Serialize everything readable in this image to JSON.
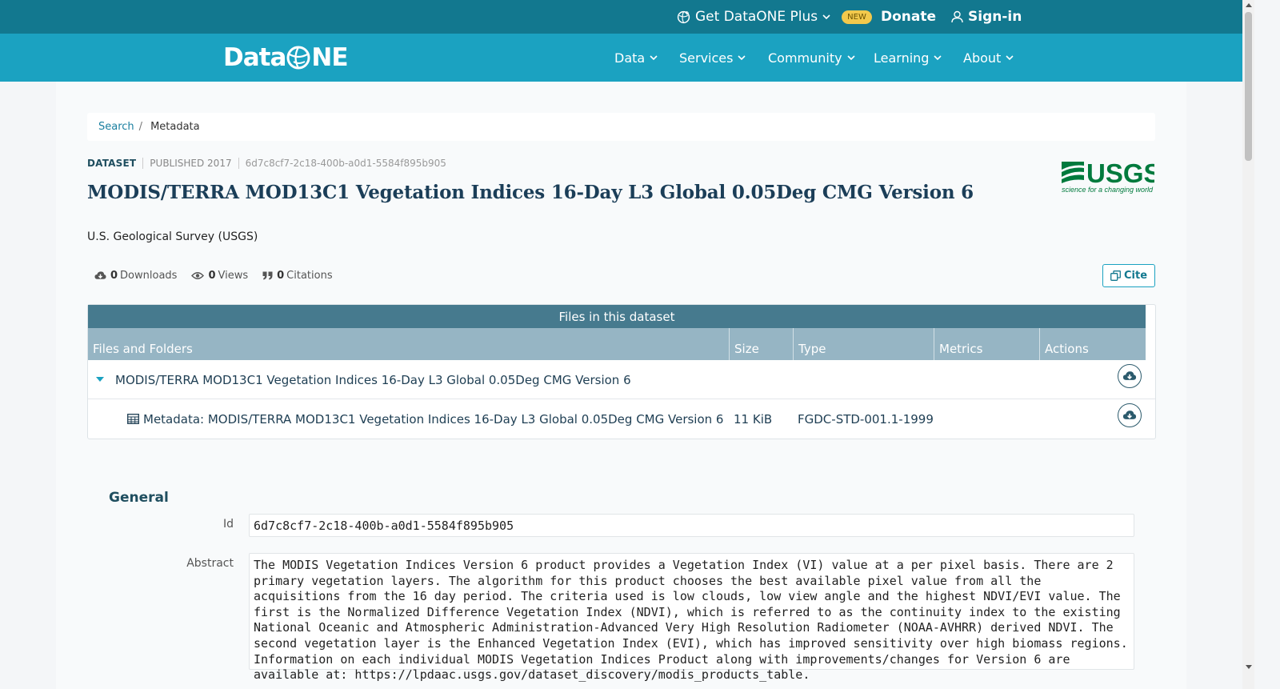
{
  "topbar": {
    "plus_label": "Get DataONE Plus",
    "new_badge": "NEW",
    "donate_label": "Donate",
    "signin_label": "Sign-in"
  },
  "logo": {
    "left": "Data",
    "right": "NE"
  },
  "nav": {
    "items": [
      {
        "label": "Data"
      },
      {
        "label": "Services"
      },
      {
        "label": "Community"
      },
      {
        "label": "Learning"
      },
      {
        "label": "About"
      }
    ]
  },
  "breadcrumb": {
    "search": "Search",
    "sep": "/",
    "current": "Metadata"
  },
  "dataset": {
    "type": "DATASET",
    "published": "PUBLISHED 2017",
    "id": "6d7c8cf7-2c18-400b-a0d1-5584f895b905",
    "title": "MODIS/TERRA MOD13C1 Vegetation Indices 16-Day L3 Global 0.05Deg CMG Version 6",
    "organization": "U.S. Geological Survey (USGS)"
  },
  "usgs_logo": {
    "text": "USGS",
    "tagline": "science for a changing world",
    "color": "#007a3d"
  },
  "metrics": {
    "downloads": {
      "count": "0",
      "label": "Downloads"
    },
    "views": {
      "count": "0",
      "label": "Views"
    },
    "citations": {
      "count": "0",
      "label": "Citations"
    }
  },
  "cite_label": "Cite",
  "files": {
    "caption": "Files in this dataset",
    "columns": [
      "Files and Folders",
      "Size",
      "Type",
      "Metrics",
      "Actions"
    ],
    "folder": {
      "name": "MODIS/TERRA MOD13C1 Vegetation Indices 16-Day L3 Global 0.05Deg CMG Version 6"
    },
    "rows": [
      {
        "name": "Metadata: MODIS/TERRA MOD13C1 Vegetation Indices 16-Day L3 Global 0.05Deg CMG Version 6",
        "size": "11 KiB",
        "type": "FGDC-STD-001.1-1999"
      }
    ]
  },
  "general": {
    "heading": "General",
    "id_label": "Id",
    "id_value": "6d7c8cf7-2c18-400b-a0d1-5584f895b905",
    "abstract_label": "Abstract",
    "abstract_value": "The MODIS Vegetation Indices Version 6 product provides a Vegetation Index (VI) value at a per pixel basis. There are 2 primary vegetation layers. The algorithm for this product chooses the best available pixel value from all the acquisitions from the 16 day period. The criteria used is low clouds, low view angle and the highest NDVI/EVI value. The first is the Normalized Difference Vegetation Index (NDVI), which is referred to as the continuity index to the existing National Oceanic and Atmospheric Administration-Advanced Very High Resolution Radiometer (NOAA-AVHRR) derived NDVI. The second vegetation layer is the Enhanced Vegetation Index (EVI), which has improved sensitivity over high biomass regions. Information on each individual MODIS Vegetation Indices Product along with improvements/changes for Version 6 are available at: https://lpdaac.usgs.gov/dataset_discovery/modis_products_table."
  },
  "colors": {
    "topbar": "#12788f",
    "nav": "#1ba2c1",
    "table_caption": "#467a8e",
    "table_head": "#96b5c4",
    "title": "#1b3e58"
  }
}
